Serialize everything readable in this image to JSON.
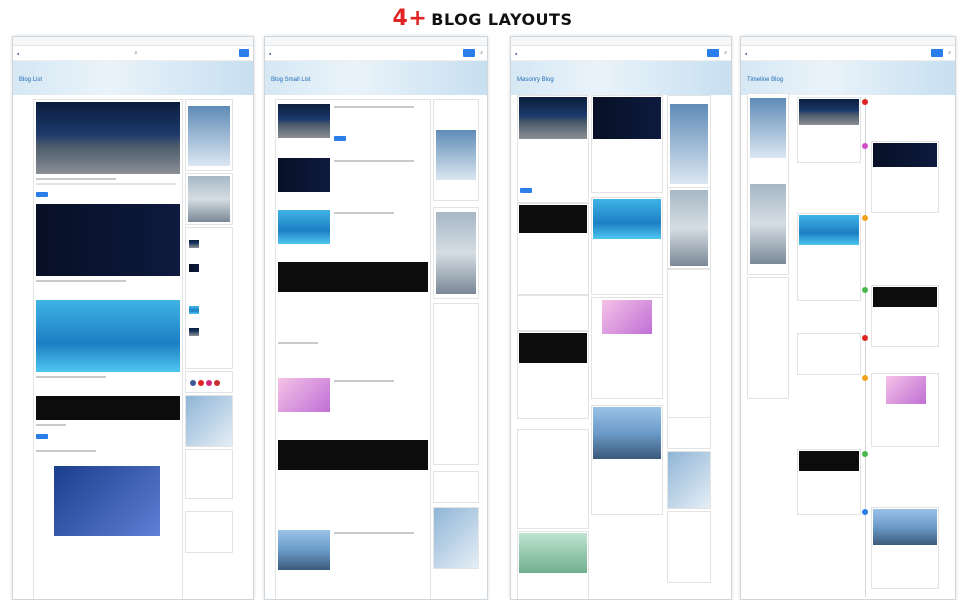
{
  "headline": {
    "number": "4+",
    "text": "BLOG LAYOUTS"
  },
  "colors": {
    "accent": "#e02424",
    "link": "#2b7de9",
    "title": "#1e6ab8"
  },
  "panels": [
    {
      "title": "Blog List"
    },
    {
      "title": "Blog Small List"
    },
    {
      "title": "Masonry Blog"
    },
    {
      "title": "Timeline Blog"
    }
  ],
  "timeline_dot_colors": [
    "#e02424",
    "#d14ec9",
    "#f2a31b",
    "#49b84a",
    "#e02424",
    "#f2a31b",
    "#49b84a",
    "#2b7de9"
  ]
}
